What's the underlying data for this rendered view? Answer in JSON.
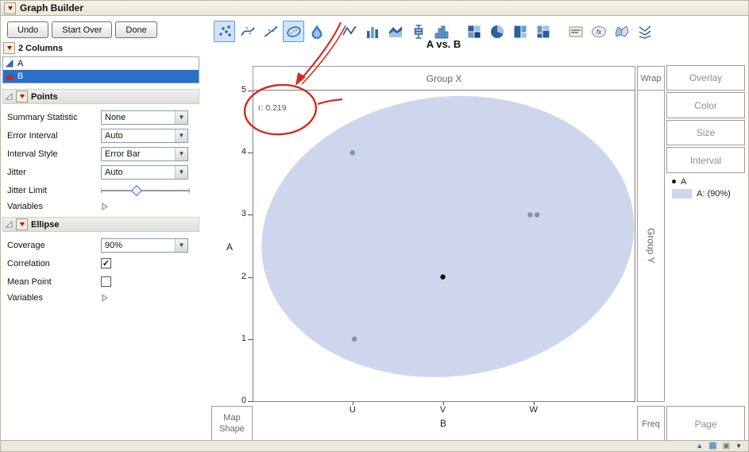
{
  "window": {
    "title": "Graph Builder"
  },
  "action_buttons": {
    "undo": "Undo",
    "start_over": "Start Over",
    "done": "Done"
  },
  "graph_toolbar": {
    "items": [
      {
        "name": "points",
        "selected": true
      },
      {
        "name": "smoother",
        "selected": false
      },
      {
        "name": "line-of-fit",
        "selected": false
      },
      {
        "name": "ellipse",
        "selected": true
      },
      {
        "name": "contour",
        "selected": false
      },
      {
        "name": "line",
        "selected": false
      },
      {
        "name": "bar",
        "selected": false
      },
      {
        "name": "area",
        "selected": false
      },
      {
        "name": "box-plot",
        "selected": false
      },
      {
        "name": "histogram",
        "selected": false
      },
      {
        "name": "heatmap",
        "selected": false
      },
      {
        "name": "pie",
        "selected": false
      },
      {
        "name": "treemap",
        "selected": false
      },
      {
        "name": "mosaic",
        "selected": false
      },
      {
        "name": "caption-box",
        "selected": false
      },
      {
        "name": "formula",
        "selected": false
      },
      {
        "name": "map-shapes",
        "selected": false
      },
      {
        "name": "parallel-plot",
        "selected": false
      }
    ]
  },
  "columns_panel": {
    "header": "2 Columns",
    "items": [
      {
        "label": "A",
        "type": "continuous",
        "selected": false
      },
      {
        "label": "B",
        "type": "nominal",
        "selected": true
      }
    ]
  },
  "points_panel": {
    "header": "Points",
    "rows": [
      {
        "label": "Summary Statistic",
        "value": "None"
      },
      {
        "label": "Error Interval",
        "value": "Auto"
      },
      {
        "label": "Interval Style",
        "value": "Error Bar"
      },
      {
        "label": "Jitter",
        "value": "Auto"
      },
      {
        "label": "Jitter Limit"
      },
      {
        "label": "Variables"
      }
    ]
  },
  "ellipse_panel": {
    "header": "Ellipse",
    "rows": [
      {
        "label": "Coverage",
        "value": "90%"
      },
      {
        "label": "Correlation",
        "checked": true
      },
      {
        "label": "Mean Point",
        "checked": false
      },
      {
        "label": "Variables"
      }
    ]
  },
  "chart": {
    "zones": {
      "group_x": "Group X",
      "wrap": "Wrap",
      "group_y": "Group Y",
      "overlay": "Overlay",
      "color": "Color",
      "size": "Size",
      "interval": "Interval",
      "map_shape": "Map Shape",
      "freq": "Freq",
      "page": "Page"
    },
    "legend": {
      "point_series_label": "A",
      "ellipse_series_label": "A: (90%)",
      "ellipse_swatch_color": "#cdd6ec"
    }
  },
  "chart_data": {
    "type": "scatter",
    "title": "A vs. B",
    "xlabel": "B",
    "ylabel": "A",
    "x_categories": [
      "U",
      "V",
      "W"
    ],
    "y_ticks": [
      0,
      1,
      2,
      3,
      4,
      5
    ],
    "ylim": [
      0,
      5
    ],
    "points": [
      {
        "x": "U",
        "y": 4,
        "color": "#909090",
        "jitter": 0
      },
      {
        "x": "U",
        "y": 1,
        "color": "#909090",
        "jitter": 0.005
      },
      {
        "x": "V",
        "y": 2,
        "color": "#111111",
        "jitter": 0
      },
      {
        "x": "W",
        "y": 3,
        "color": "#909090",
        "jitter": -0.009
      },
      {
        "x": "W",
        "y": 3,
        "color": "#909090",
        "jitter": 0.009
      }
    ],
    "ellipse": {
      "coverage": "90%",
      "fill": "#cdd6ec",
      "center_x_frac": 0.51,
      "center_y_value": 2.65,
      "rx_frac": 0.49,
      "ry_value_span": 2.25,
      "angle_deg": -7
    },
    "correlation_label": "r: 0.219"
  },
  "annotation": {
    "color": "#d42a1e"
  },
  "status_bar": {
    "icons": [
      "caret-up",
      "grid",
      "window",
      "menu-down"
    ]
  }
}
